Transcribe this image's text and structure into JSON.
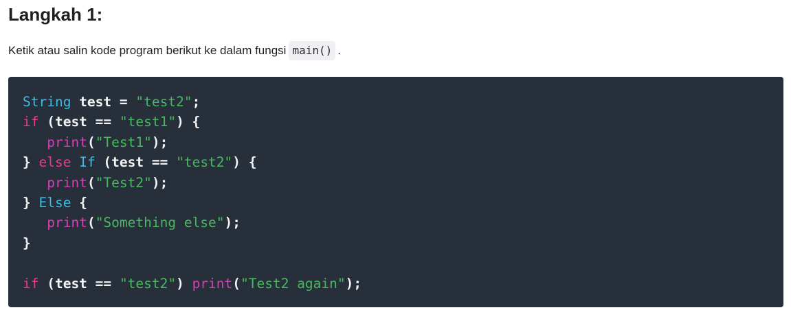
{
  "heading": "Langkah 1:",
  "paragraph": {
    "before": "Ketik atau salin kode program berikut ke dalam fungsi",
    "code": "main()",
    "after": "."
  },
  "code_lines": [
    [
      [
        "type",
        "String"
      ],
      [
        "plain",
        " test = "
      ],
      [
        "str",
        "\"test2\""
      ],
      [
        "plain",
        ";"
      ]
    ],
    [
      [
        "kw",
        "if"
      ],
      [
        "plain",
        " (test == "
      ],
      [
        "str",
        "\"test1\""
      ],
      [
        "plain",
        ") {"
      ]
    ],
    [
      [
        "plain",
        "   "
      ],
      [
        "fn",
        "print"
      ],
      [
        "plain",
        "("
      ],
      [
        "str",
        "\"Test1\""
      ],
      [
        "plain",
        ");"
      ]
    ],
    [
      [
        "plain",
        "} "
      ],
      [
        "kw",
        "else"
      ],
      [
        "plain",
        " "
      ],
      [
        "type",
        "If"
      ],
      [
        "plain",
        " (test == "
      ],
      [
        "str",
        "\"test2\""
      ],
      [
        "plain",
        ") {"
      ]
    ],
    [
      [
        "plain",
        "   "
      ],
      [
        "fn",
        "print"
      ],
      [
        "plain",
        "("
      ],
      [
        "str",
        "\"Test2\""
      ],
      [
        "plain",
        ");"
      ]
    ],
    [
      [
        "plain",
        "} "
      ],
      [
        "type",
        "Else"
      ],
      [
        "plain",
        " {"
      ]
    ],
    [
      [
        "plain",
        "   "
      ],
      [
        "fn",
        "print"
      ],
      [
        "plain",
        "("
      ],
      [
        "str",
        "\"Something else\""
      ],
      [
        "plain",
        ");"
      ]
    ],
    [
      [
        "plain",
        "}"
      ]
    ],
    [],
    [
      [
        "kw",
        "if"
      ],
      [
        "plain",
        " (test == "
      ],
      [
        "str",
        "\"test2\""
      ],
      [
        "plain",
        ") "
      ],
      [
        "fn",
        "print"
      ],
      [
        "plain",
        "("
      ],
      [
        "str",
        "\"Test2 again\""
      ],
      [
        "plain",
        ");"
      ]
    ]
  ]
}
